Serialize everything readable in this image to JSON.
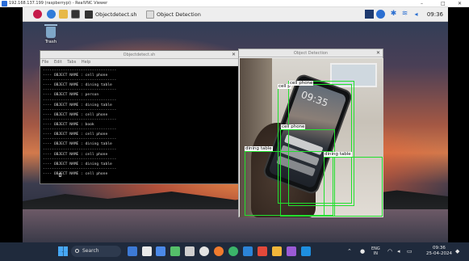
{
  "vnc": {
    "title": "192.168.137.199 (raspberrypi) - RealVNC Viewer",
    "minimize": "–",
    "maximize": "□",
    "close": "✕"
  },
  "rpi_taskbar": {
    "tasks": [
      {
        "label": "Objectdetect.sh"
      },
      {
        "label": "Object Detection"
      }
    ],
    "clock": "09:36"
  },
  "desktop": {
    "trash_label": "Trash"
  },
  "terminal": {
    "title": "Objectdetect.sh",
    "menu": [
      "File",
      "Edit",
      "Tabs",
      "Help"
    ],
    "lines": [
      "---------------------------------",
      "---- OBJECT NAME : cell phone",
      "---------------------------------",
      "---- OBJECT NAME : dining table",
      "---------------------------------",
      "---- OBJECT NAME : person",
      "---------------------------------",
      "---- OBJECT NAME : dining table",
      "---------------------------------",
      "---- OBJECT NAME : cell phone",
      "---------------------------------",
      "---- OBJECT NAME : book",
      "---------------------------------",
      "---- OBJECT NAME : cell phone",
      "---------------------------------",
      "---- OBJECT NAME : dining table",
      "---------------------------------",
      "---- OBJECT NAME : cell phone",
      "---------------------------------",
      "---- OBJECT NAME : dining table",
      "---------------------------------",
      "---- OBJECT NAME : cell phone"
    ]
  },
  "detection": {
    "title": "Object Detection",
    "phone_time": "09:35",
    "labels": {
      "cell_top_a": "cell p",
      "cell_top_b": "cell phone",
      "cell_mid": "cell phone",
      "dining_left": "dining table",
      "dining_right": "dining table"
    }
  },
  "win_taskbar": {
    "search_label": "Search",
    "lang_top": "ENG",
    "lang_bottom": "IN",
    "time": "09:36",
    "date": "25-04-2024"
  }
}
